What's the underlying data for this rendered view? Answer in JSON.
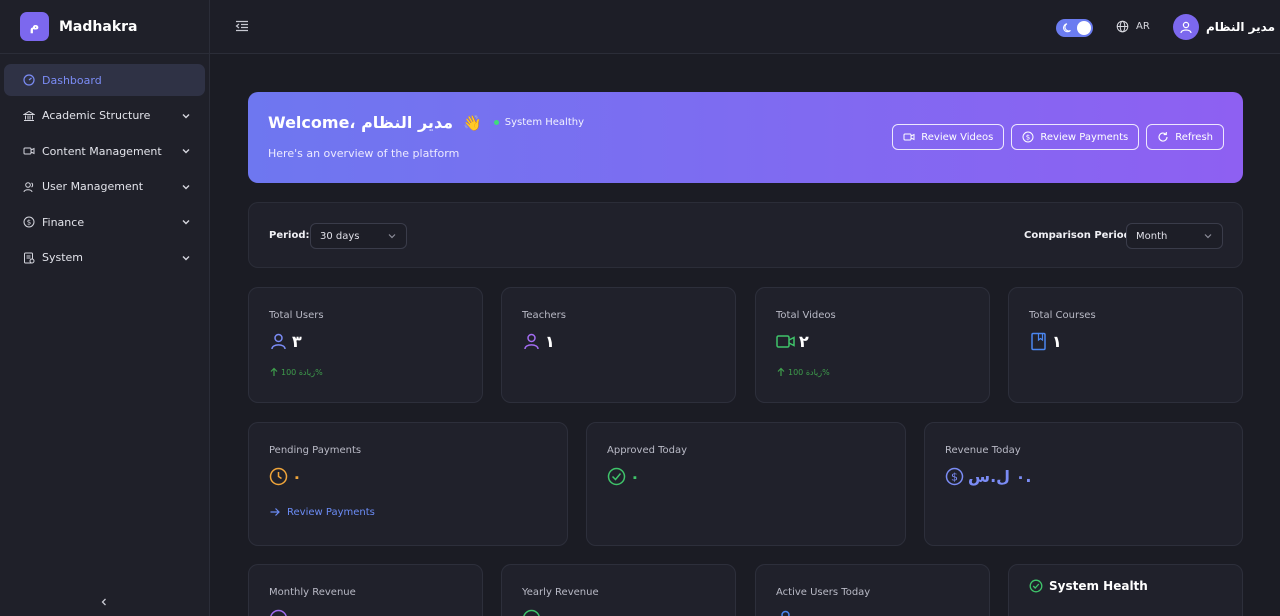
{
  "brand": {
    "logo_letter": "م",
    "name": "Madhakra"
  },
  "sidebar": {
    "items": [
      {
        "label": "Dashboard",
        "icon": "gauge-icon",
        "active": true
      },
      {
        "label": "Academic Structure",
        "icon": "institution-icon"
      },
      {
        "label": "Content Management",
        "icon": "video-icon"
      },
      {
        "label": "User Management",
        "icon": "users-icon"
      },
      {
        "label": "Finance",
        "icon": "dollar-circle-icon"
      },
      {
        "label": "System",
        "icon": "system-icon"
      }
    ]
  },
  "topbar": {
    "language": "AR",
    "user_name": "مدير النظام"
  },
  "banner": {
    "welcome": "Welcome، مدير النظام",
    "wave": "👋",
    "status": "System Healthy",
    "subtitle": "Here's an overview of the platform",
    "actions": [
      "Review Videos",
      "Review Payments",
      "Refresh"
    ]
  },
  "filters": {
    "period_label": "Period:",
    "period_value": "30 days",
    "comparison_label": "Comparison Period:",
    "comparison_value": "Month"
  },
  "stats": [
    {
      "title": "Total Users",
      "value": "٣",
      "trend": "زيادة 100%"
    },
    {
      "title": "Teachers",
      "value": "١"
    },
    {
      "title": "Total Videos",
      "value": "٢",
      "trend": "زيادة 100%"
    },
    {
      "title": "Total Courses",
      "value": "١"
    }
  ],
  "finance": [
    {
      "title": "Pending Payments",
      "value": "٠",
      "link": "Review Payments"
    },
    {
      "title": "Approved Today",
      "value": "٠"
    },
    {
      "title": "Revenue Today",
      "value": "٠ ل.س."
    }
  ],
  "bottom": [
    {
      "title": "Monthly Revenue"
    },
    {
      "title": "Yearly Revenue"
    },
    {
      "title": "Active Users Today"
    }
  ],
  "health": {
    "title": "System Health"
  },
  "colors": {
    "accent": "#7c68ee",
    "link": "#6b8cf5",
    "success": "#3fdc7a",
    "warning": "#f0a53a"
  }
}
